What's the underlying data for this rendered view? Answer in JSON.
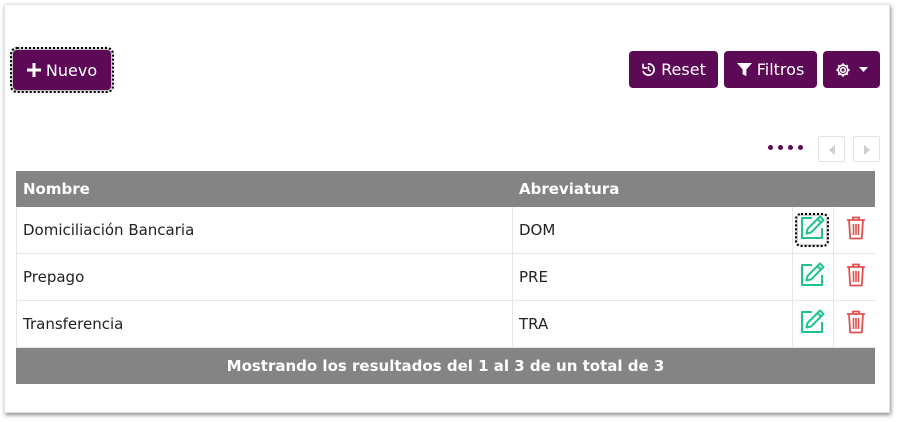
{
  "toolbar": {
    "new_label": "Nuevo",
    "reset_label": "Reset",
    "filters_label": "Filtros"
  },
  "table": {
    "columns": [
      "Nombre",
      "Abreviatura"
    ],
    "rows": [
      {
        "nombre": "Domiciliación Bancaria",
        "abreviatura": "DOM"
      },
      {
        "nombre": "Prepago",
        "abreviatura": "PRE"
      },
      {
        "nombre": "Transferencia",
        "abreviatura": "TRA"
      }
    ],
    "footer": "Mostrando los resultados del 1 al 3 de un total de 3"
  },
  "icons": {
    "plus": "plus-icon",
    "reset": "history-icon",
    "filter": "filter-icon",
    "settings": "gear-icon",
    "edit": "edit-icon",
    "delete": "trash-icon"
  },
  "colors": {
    "brand": "#5c0a55",
    "header": "#848484",
    "edit": "#1ec48f",
    "delete": "#e05050"
  }
}
